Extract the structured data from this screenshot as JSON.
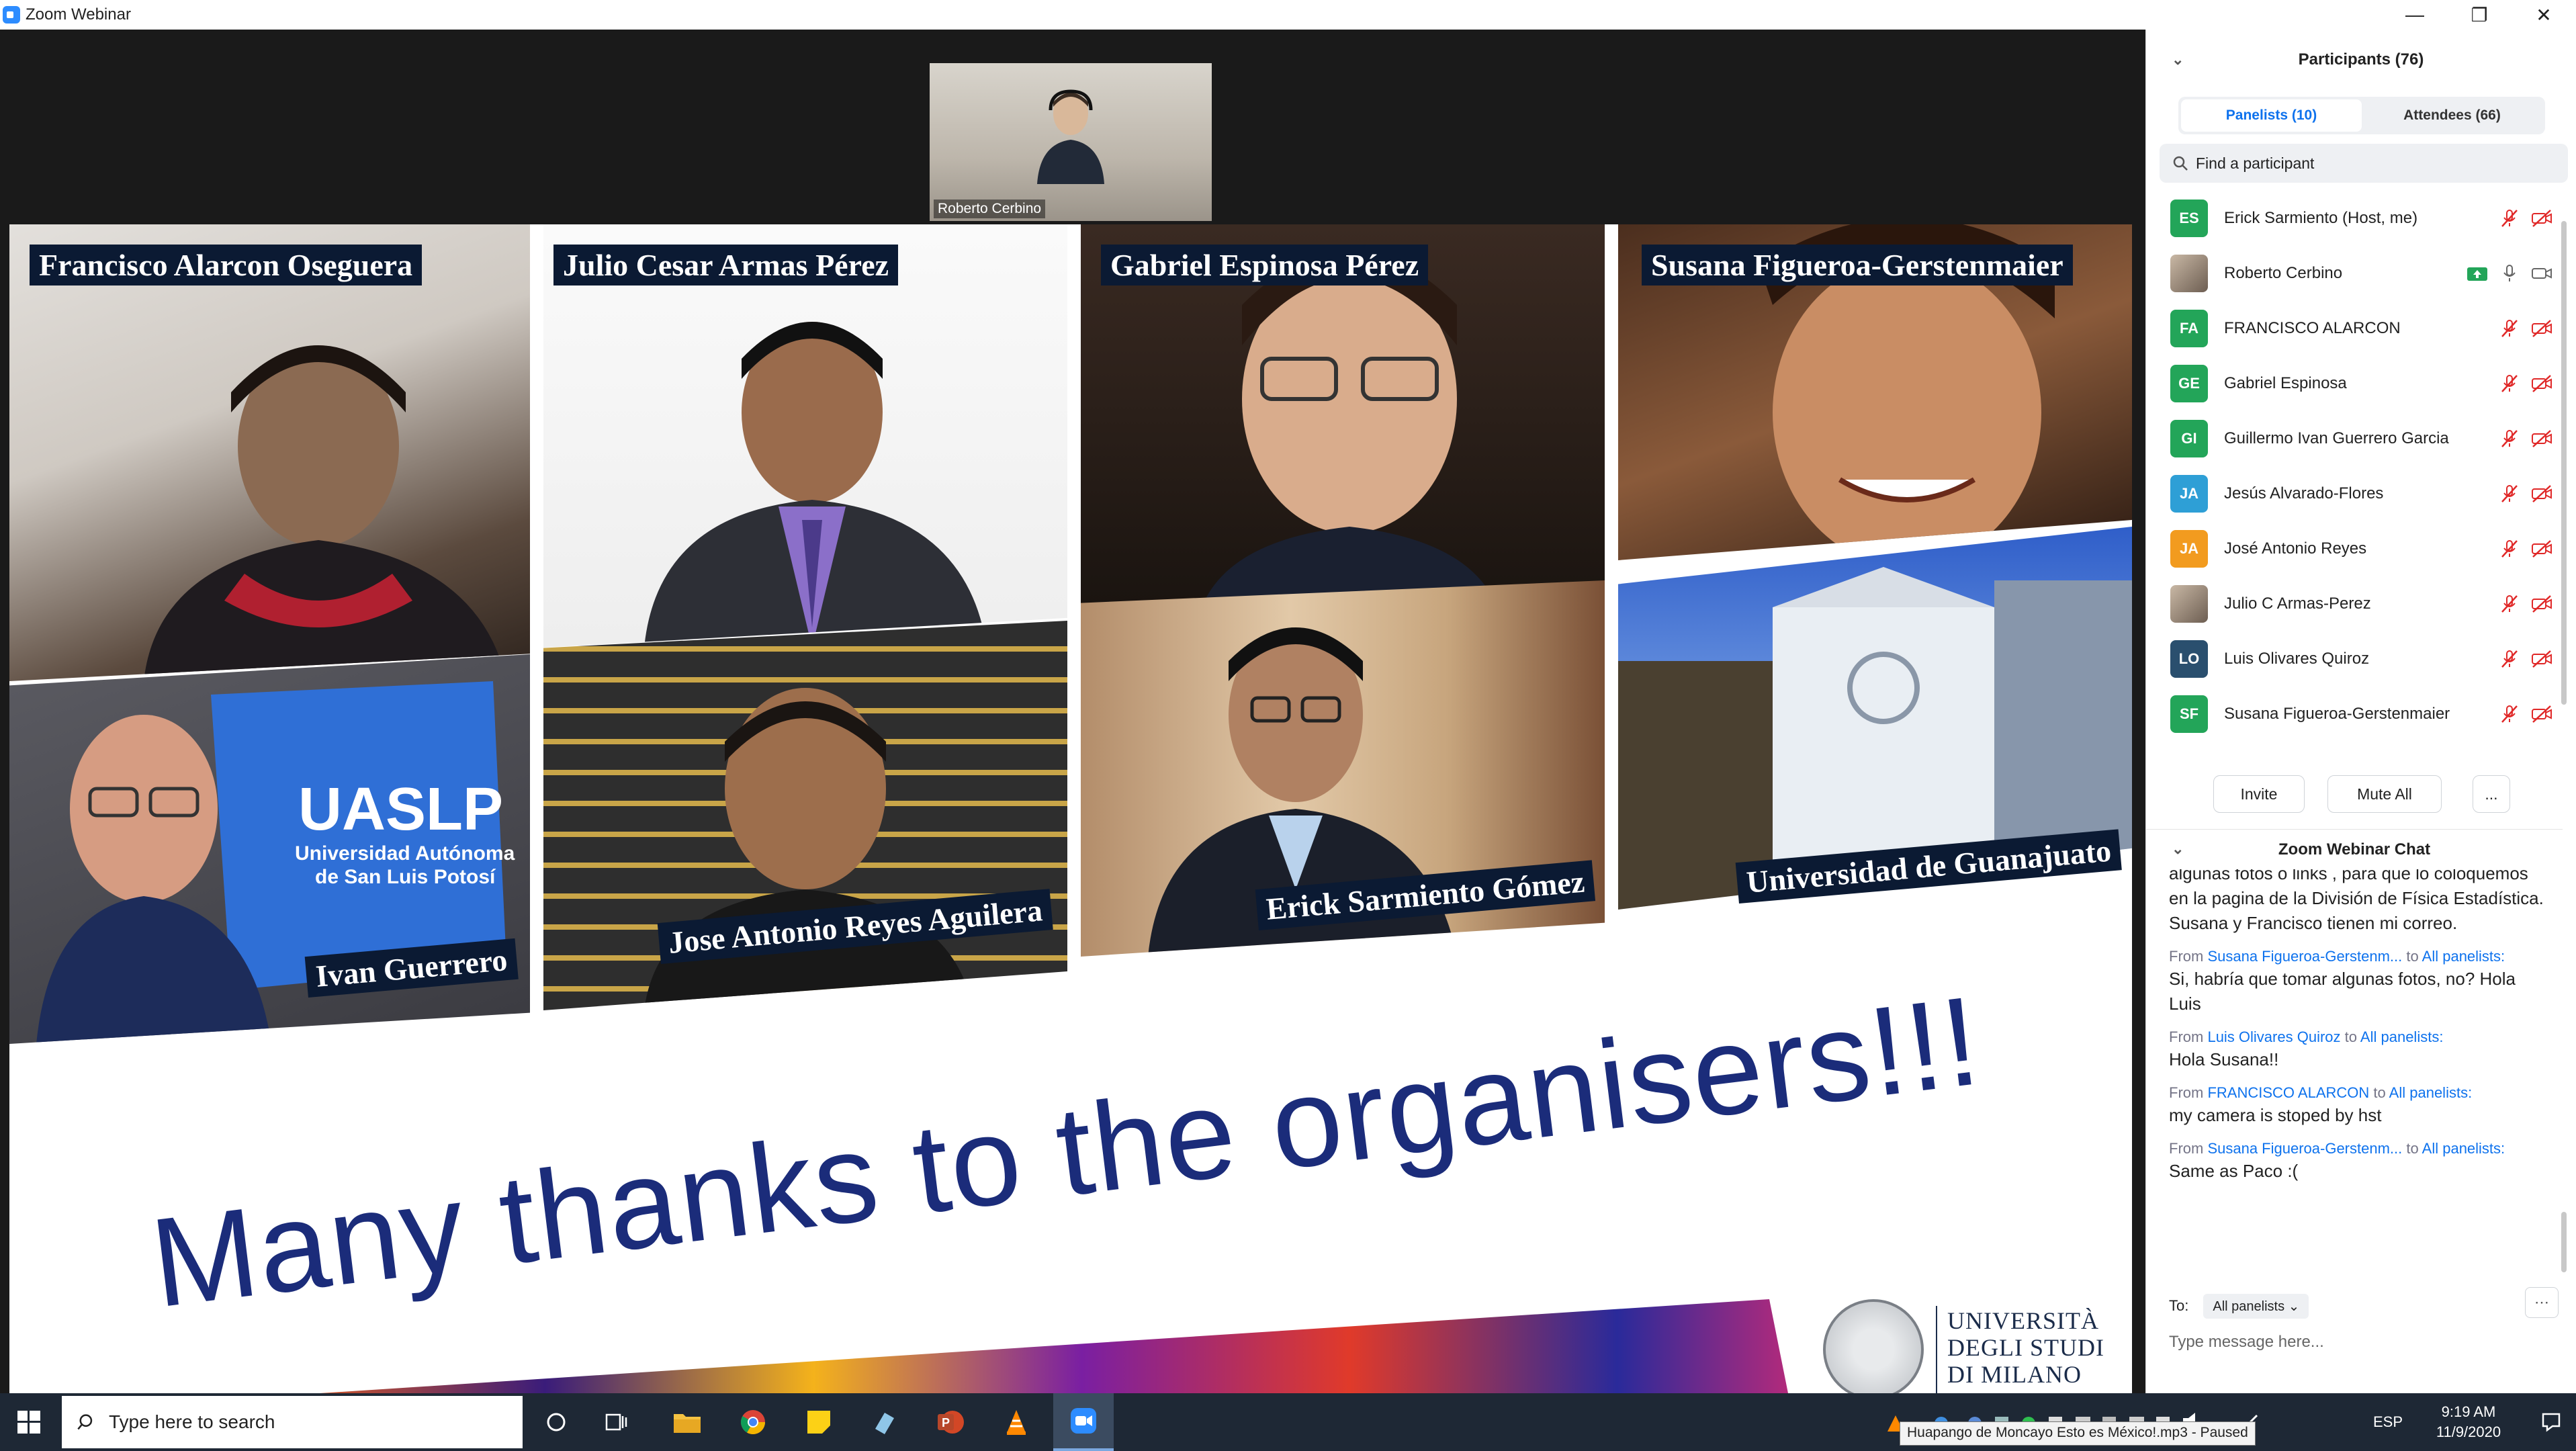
{
  "window": {
    "title": "Zoom Webinar",
    "minimize": "—",
    "restore": "❐",
    "close": "✕"
  },
  "thumbnail": {
    "name": "Roberto Cerbino"
  },
  "slide": {
    "names": {
      "n1": "Francisco Alarcon Oseguera",
      "n2": "Julio Cesar Armas Pérez",
      "n3": "Gabriel Espinosa Pérez",
      "n4": "Susana Figueroa-Gerstenmaier",
      "n5": "Ivan Guerrero",
      "n6": "Jose Antonio Reyes Aguilera",
      "n7": "Erick Sarmiento Gómez",
      "n8": "Universidad de Guanajuato"
    },
    "uaslp": {
      "big": "UASLP",
      "line1": "Universidad Autónoma",
      "line2": "de San Luis Potosí"
    },
    "thanks": "Many thanks to the organisers!!!",
    "university": {
      "l1": "UNIVERSITÀ",
      "l2": "DEGLI STUDI",
      "l3": "DI MILANO"
    }
  },
  "panel": {
    "participants_title": "Participants (76)",
    "tab_panelists": "Panelists (10)",
    "tab_attendees": "Attendees (66)",
    "search_placeholder": "Find a participant",
    "participants": [
      {
        "initials": "ES",
        "name": "Erick Sarmiento (Host, me)",
        "color": "#23a559"
      },
      {
        "initials": "",
        "name": "Roberto Cerbino",
        "color": "#8a7a6e"
      },
      {
        "initials": "FA",
        "name": "FRANCISCO ALARCON",
        "color": "#23a559"
      },
      {
        "initials": "GE",
        "name": "Gabriel Espinosa",
        "color": "#23a559"
      },
      {
        "initials": "GI",
        "name": "Guillermo Ivan Guerrero Garcia",
        "color": "#23a559"
      },
      {
        "initials": "JA",
        "name": "Jesús Alvarado-Flores",
        "color": "#2e9fd6"
      },
      {
        "initials": "JA",
        "name": "José Antonio Reyes",
        "color": "#f29b1f"
      },
      {
        "initials": "",
        "name": "Julio C Armas-Perez",
        "color": "#6b6e73"
      },
      {
        "initials": "LO",
        "name": "Luis Olivares Quiroz",
        "color": "#2a4f6e"
      },
      {
        "initials": "SF",
        "name": "Susana Figueroa-Gerstenmaier",
        "color": "#23a559"
      }
    ],
    "btn_invite": "Invite",
    "btn_mute_all": "Mute All",
    "btn_more": "...",
    "chat_title": "Zoom Webinar Chat",
    "chat": {
      "first_text": "algunas fotos o links , para que lo coloquemos en la pagina de la División de Física Estadística. Susana y Francisco tienen mi correo.",
      "messages": [
        {
          "from_label": "From",
          "sender": "Susana Figueroa-Gerstenm...",
          "to_label": "to",
          "recipient": "All panelists:",
          "text": "Si, habría que tomar algunas fotos, no? Hola Luis"
        },
        {
          "from_label": "From",
          "sender": "Luis Olivares Quiroz",
          "to_label": "to",
          "recipient": "All panelists:",
          "text": "Hola Susana!!"
        },
        {
          "from_label": "From",
          "sender": "FRANCISCO ALARCON",
          "to_label": "to",
          "recipient": "All panelists:",
          "text": "my camera is stoped by hst"
        },
        {
          "from_label": "From",
          "sender": "Susana Figueroa-Gerstenm...",
          "to_label": "to",
          "recipient": "All panelists:",
          "text": "Same as Paco :("
        }
      ]
    },
    "to_label": "To:",
    "to_value": "All panelists",
    "input_placeholder": "Type message here..."
  },
  "taskbar": {
    "search_placeholder": "Type here to search",
    "language": "ESP",
    "time": "9:19 AM",
    "date": "11/9/2020",
    "tooltip": "Huapango de Moncayo Esto es México!.mp3 - Paused"
  }
}
